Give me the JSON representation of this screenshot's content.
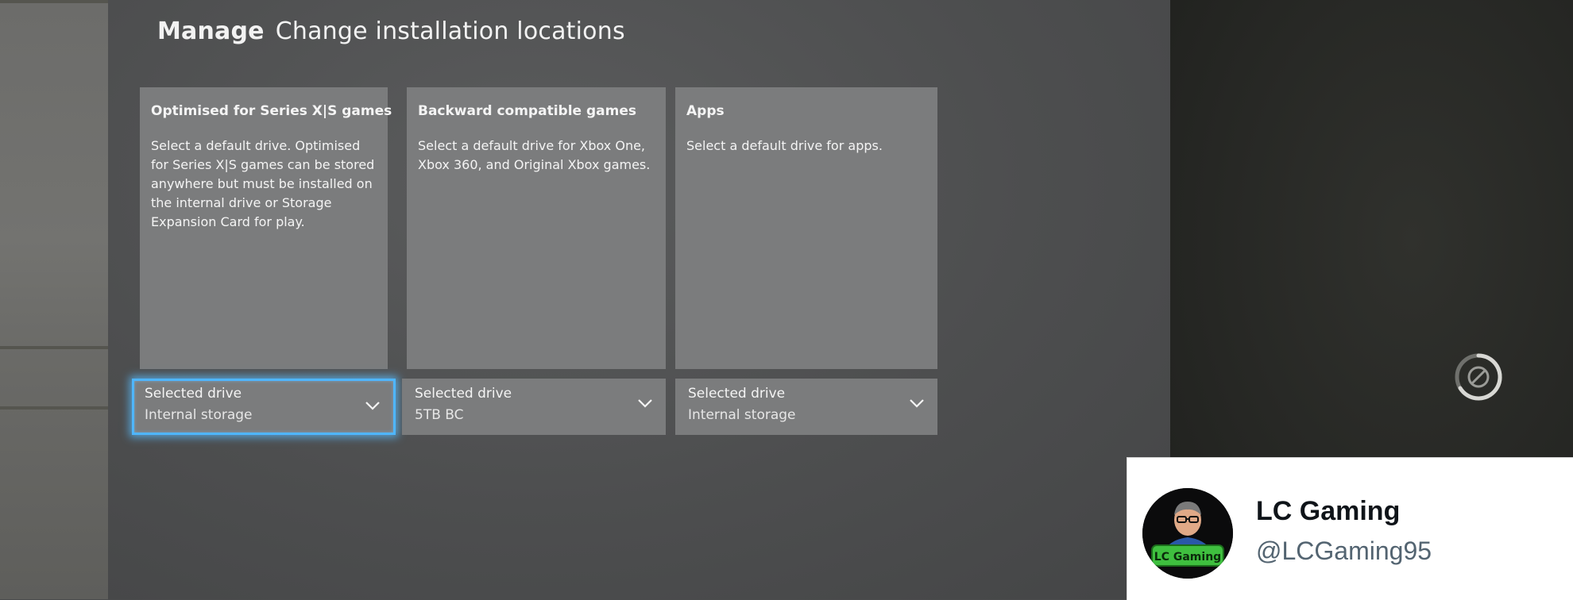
{
  "header": {
    "section": "Manage",
    "title": "Change installation locations"
  },
  "cards": [
    {
      "title": "Optimised for Series X|S games",
      "description": "Select a default drive. Optimised for Series X|S games can be stored anywhere but must be installed on the internal drive or Storage Expansion Card for play.",
      "dropdown_label": "Selected drive",
      "dropdown_value": "Internal storage"
    },
    {
      "title": "Backward compatible games",
      "description": "Select a default drive for Xbox One, Xbox 360, and Original Xbox games.",
      "dropdown_label": "Selected drive",
      "dropdown_value": "5TB BC"
    },
    {
      "title": "Apps",
      "description": "Select a default drive for apps.",
      "dropdown_label": "Selected drive",
      "dropdown_value": "Internal storage"
    }
  ],
  "icons": {
    "dropdown": "chevron-down-icon",
    "status": "loading-spinner-icon",
    "avatar": "lc-gaming-avatar"
  },
  "profile": {
    "name": "LC Gaming",
    "handle": "@LCGaming95",
    "avatar_text": "LC Gaming"
  },
  "colors": {
    "focus": "#4fb6ff",
    "tile": "#7b7c7d",
    "avatar_logo": "#3fbf3f"
  }
}
